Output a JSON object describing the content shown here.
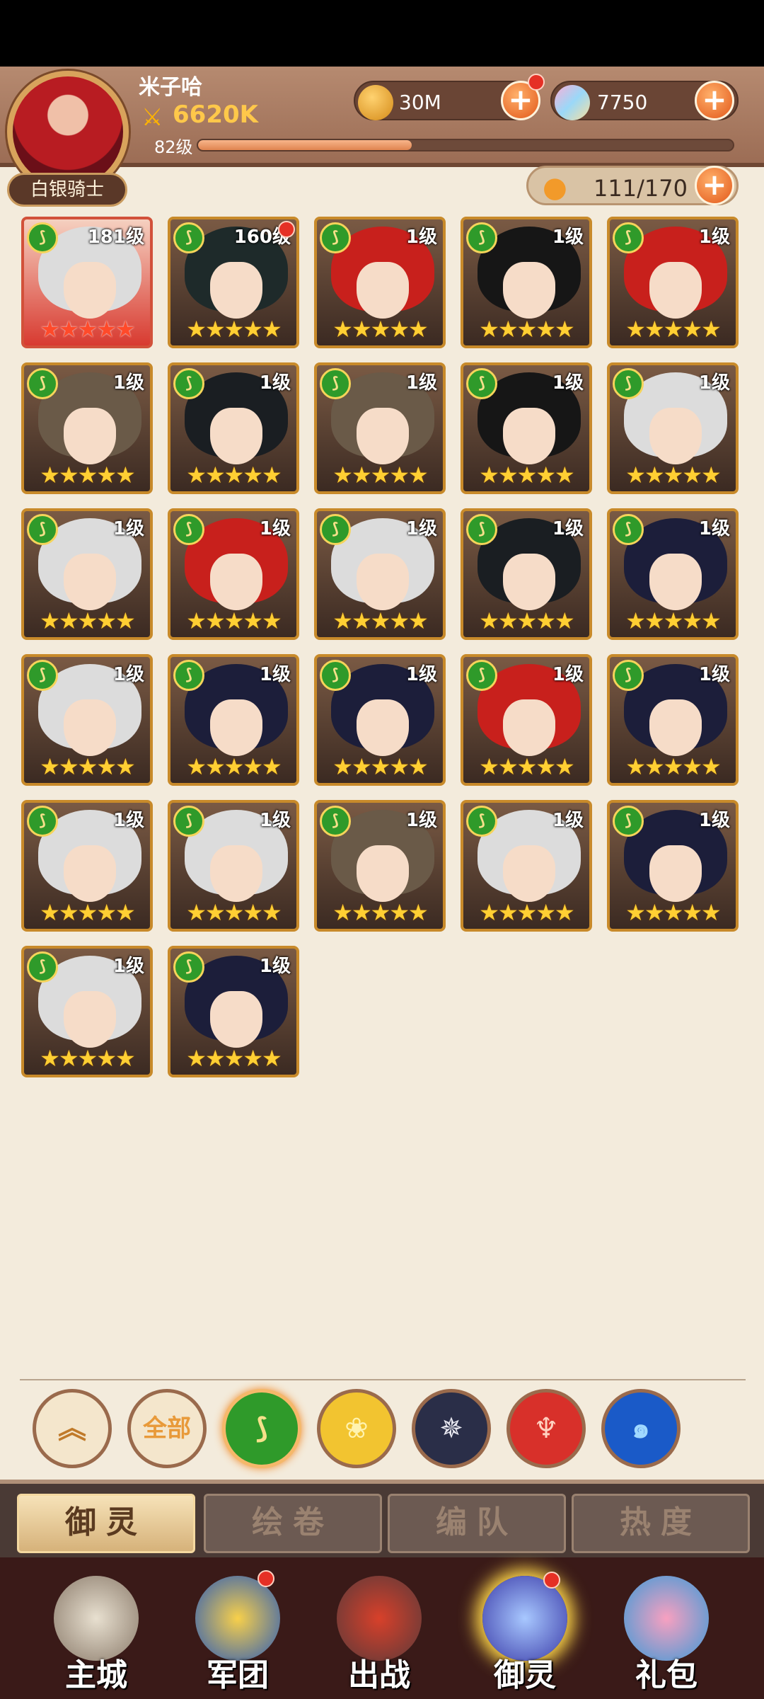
{
  "player": {
    "name": "米子哈",
    "power": "6620K",
    "level": "82级",
    "xp_fraction": 0.4,
    "title": "白银骑士"
  },
  "resources": {
    "gold": "30M",
    "gems": "7750"
  },
  "roster": {
    "count": "111/170"
  },
  "heroes": [
    {
      "level": "181级",
      "stars": "★★★★★",
      "hair": "#dcdcdc",
      "bg": "red"
    },
    {
      "level": "160级",
      "stars": "★★★★★",
      "hair": "#1e2a2a",
      "dot": true
    },
    {
      "level": "1级",
      "stars": "★★★★★",
      "hair": "#c8201c"
    },
    {
      "level": "1级",
      "stars": "★★★★★",
      "hair": "#161616"
    },
    {
      "level": "1级",
      "stars": "★★★★★",
      "hair": "#c8201c"
    },
    {
      "level": "1级",
      "stars": "★★★★★",
      "hair": "#6a5a48"
    },
    {
      "level": "1级",
      "stars": "★★★★★",
      "hair": "#1a1e22"
    },
    {
      "level": "1级",
      "stars": "★★★★★",
      "hair": "#6a5a48"
    },
    {
      "level": "1级",
      "stars": "★★★★★",
      "hair": "#161616"
    },
    {
      "level": "1级",
      "stars": "★★★★★",
      "hair": "#dcdcdc"
    },
    {
      "level": "1级",
      "stars": "★★★★★",
      "hair": "#dcdcdc"
    },
    {
      "level": "1级",
      "stars": "★★★★★",
      "hair": "#c8201c"
    },
    {
      "level": "1级",
      "stars": "★★★★★",
      "hair": "#dcdcdc"
    },
    {
      "level": "1级",
      "stars": "★★★★★",
      "hair": "#1a1e22"
    },
    {
      "level": "1级",
      "stars": "★★★★★",
      "hair": "#1c1e3a"
    },
    {
      "level": "1级",
      "stars": "★★★★★",
      "hair": "#dcdcdc"
    },
    {
      "level": "1级",
      "stars": "★★★★★",
      "hair": "#1c1e3a"
    },
    {
      "level": "1级",
      "stars": "★★★★★",
      "hair": "#1c1e3a"
    },
    {
      "level": "1级",
      "stars": "★★★★★",
      "hair": "#c8201c"
    },
    {
      "level": "1级",
      "stars": "★★★★★",
      "hair": "#1c1e3a"
    },
    {
      "level": "1级",
      "stars": "★★★★★",
      "hair": "#dcdcdc"
    },
    {
      "level": "1级",
      "stars": "★★★★★",
      "hair": "#dcdcdc"
    },
    {
      "level": "1级",
      "stars": "★★★★★",
      "hair": "#6a5a48"
    },
    {
      "level": "1级",
      "stars": "★★★★★",
      "hair": "#dcdcdc"
    },
    {
      "level": "1级",
      "stars": "★★★★★",
      "hair": "#1c1e3a"
    },
    {
      "level": "1级",
      "stars": "★★★★★",
      "hair": "#dcdcdc"
    },
    {
      "level": "1级",
      "stars": "★★★★★",
      "hair": "#1c1e3a"
    }
  ],
  "filters": {
    "all_label": "全部"
  },
  "tabs": [
    {
      "label": "御灵"
    },
    {
      "label": "绘卷"
    },
    {
      "label": "编队"
    },
    {
      "label": "热度"
    }
  ],
  "nav": [
    {
      "label": "主城"
    },
    {
      "label": "军团"
    },
    {
      "label": "出战"
    },
    {
      "label": "御灵"
    },
    {
      "label": "礼包"
    }
  ]
}
